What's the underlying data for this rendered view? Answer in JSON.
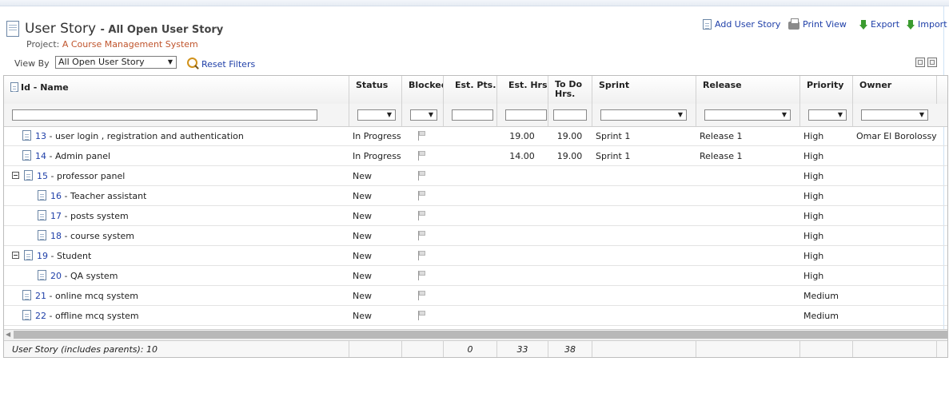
{
  "header": {
    "title": "User Story",
    "subtitle": "- All Open User Story",
    "project_label": "Project:",
    "project_name": "A Course Management System"
  },
  "actions": {
    "add": "Add User Story",
    "print": "Print View",
    "export": "Export",
    "import": "Import"
  },
  "filters": {
    "view_by_label": "View By",
    "view_by_value": "All Open User Story",
    "reset": "Reset Filters"
  },
  "columns": [
    "Id - Name",
    "Status",
    "Blocked",
    "Est. Pts.",
    "Est. Hrs.",
    "To Do Hrs.",
    "Sprint",
    "Release",
    "Priority",
    "Owner"
  ],
  "rows": [
    {
      "id": "13",
      "name": "- user login , registration and authentication",
      "status": "In Progress",
      "est_hrs": "19.00",
      "todo_hrs": "19.00",
      "sprint": "Sprint 1",
      "release": "Release 1",
      "priority": "High",
      "owner": "Omar El Borolossy",
      "level": 0,
      "parent": false
    },
    {
      "id": "14",
      "name": "- Admin panel",
      "status": "In Progress",
      "est_hrs": "14.00",
      "todo_hrs": "19.00",
      "sprint": "Sprint 1",
      "release": "Release 1",
      "priority": "High",
      "owner": "",
      "level": 0,
      "parent": false
    },
    {
      "id": "15",
      "name": "- professor panel",
      "status": "New",
      "est_hrs": "",
      "todo_hrs": "",
      "sprint": "",
      "release": "",
      "priority": "High",
      "owner": "",
      "level": 0,
      "parent": true
    },
    {
      "id": "16",
      "name": "- Teacher assistant",
      "status": "New",
      "est_hrs": "",
      "todo_hrs": "",
      "sprint": "",
      "release": "",
      "priority": "High",
      "owner": "",
      "level": 1,
      "parent": false
    },
    {
      "id": "17",
      "name": "- posts system",
      "status": "New",
      "est_hrs": "",
      "todo_hrs": "",
      "sprint": "",
      "release": "",
      "priority": "High",
      "owner": "",
      "level": 1,
      "parent": false
    },
    {
      "id": "18",
      "name": "- course system",
      "status": "New",
      "est_hrs": "",
      "todo_hrs": "",
      "sprint": "",
      "release": "",
      "priority": "High",
      "owner": "",
      "level": 1,
      "parent": false
    },
    {
      "id": "19",
      "name": "- Student",
      "status": "New",
      "est_hrs": "",
      "todo_hrs": "",
      "sprint": "",
      "release": "",
      "priority": "High",
      "owner": "",
      "level": 0,
      "parent": true
    },
    {
      "id": "20",
      "name": "- QA system",
      "status": "New",
      "est_hrs": "",
      "todo_hrs": "",
      "sprint": "",
      "release": "",
      "priority": "High",
      "owner": "",
      "level": 1,
      "parent": false
    },
    {
      "id": "21",
      "name": "- online mcq system",
      "status": "New",
      "est_hrs": "",
      "todo_hrs": "",
      "sprint": "",
      "release": "",
      "priority": "Medium",
      "owner": "",
      "level": 0,
      "parent": false
    },
    {
      "id": "22",
      "name": "- offline mcq system",
      "status": "New",
      "est_hrs": "",
      "todo_hrs": "",
      "sprint": "",
      "release": "",
      "priority": "Medium",
      "owner": "",
      "level": 0,
      "parent": false
    }
  ],
  "footer": {
    "summary": "User Story (includes parents): 10",
    "est_pts": "0",
    "est_hrs": "33",
    "todo_hrs": "38"
  }
}
